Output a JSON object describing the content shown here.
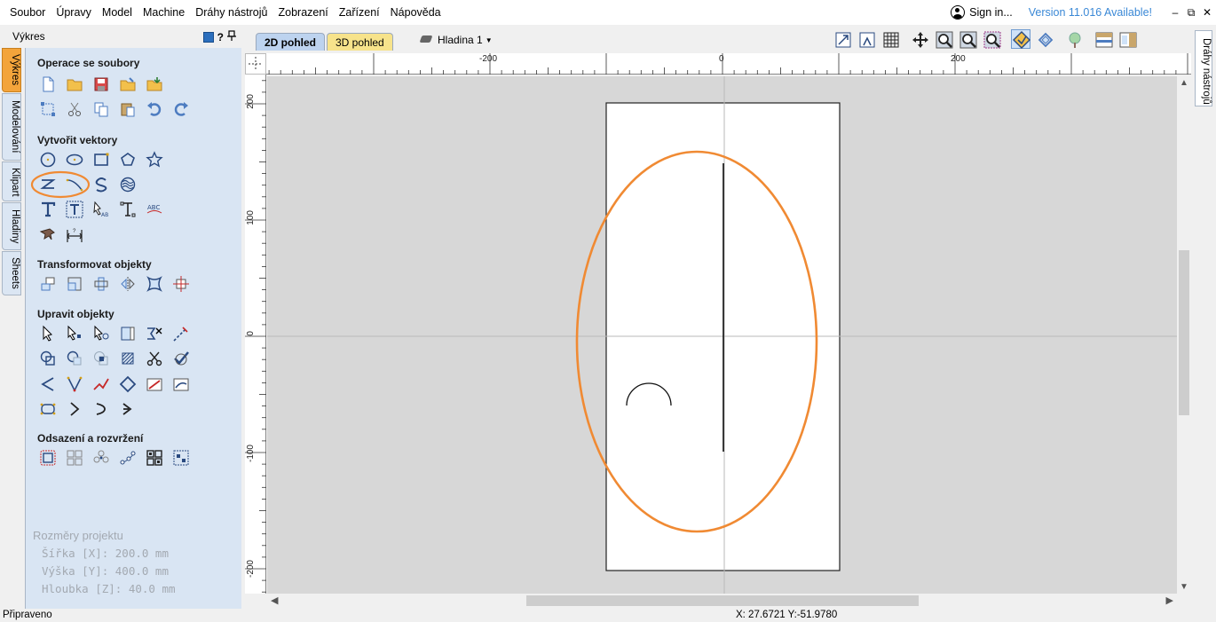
{
  "menu": {
    "items": [
      "Soubor",
      "Úpravy",
      "Model",
      "Machine",
      "Dráhy nástrojů",
      "Zobrazení",
      "Zařízení",
      "Nápověda"
    ],
    "sign_in": "Sign in...",
    "version": "Version 11.016 Available!",
    "window_buttons": [
      "–",
      "⧉",
      "✕"
    ]
  },
  "panel": {
    "title": "Výkres",
    "help": "?",
    "side_tabs": [
      "Výkres",
      "Modelování",
      "Klipart",
      "Hladiny",
      "Sheets"
    ],
    "active_tab": "Výkres",
    "sections": {
      "files": "Operace se soubory",
      "vectors": "Vytvořit vektory",
      "transform": "Transformovat objekty",
      "edit": "Upravit objekty",
      "offset": "Odsazení a rozvržení"
    },
    "project": {
      "title": "Rozměry projektu",
      "width": "Šířka   [X]: 200.0 mm",
      "height": "Výška   [Y]: 400.0 mm",
      "depth": "Hloubka [Z]: 40.0 mm"
    }
  },
  "view": {
    "tab_2d": "2D pohled",
    "tab_3d": "3D pohled",
    "layer": "Hladina 1",
    "right_tab": "Dráhy nástrojů"
  },
  "ruler": {
    "h_labels": [
      "-200",
      "0",
      "200"
    ],
    "v_labels": [
      "200",
      "100",
      "0",
      "-100",
      "-200"
    ]
  },
  "status": {
    "text": "Připraveno",
    "coords": "X: 27.6721 Y:-51.9780"
  },
  "colors": {
    "highlight": "#f08a33",
    "panel_bg": "#d9e5f3",
    "tab_active": "#f3a43b",
    "link": "#3a88d6"
  }
}
